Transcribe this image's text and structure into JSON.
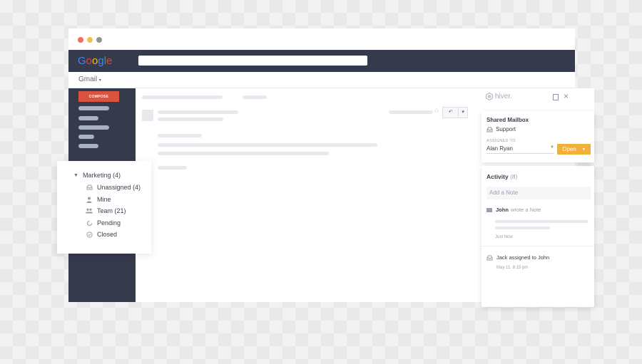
{
  "colors": {
    "topbar": "#353a4c",
    "sidebar": "#353a4c",
    "compose": "#d9533f",
    "open_button": "#f0b039",
    "dot_red": "#ee6b5e",
    "dot_yellow": "#f5bf4f",
    "dot_grey": "#8f9590",
    "google_blue": "#4285f4",
    "google_red": "#ea4335",
    "google_yellow": "#fbbc05",
    "google_green": "#34a853"
  },
  "browser": {
    "logo": [
      "G",
      "o",
      "o",
      "g",
      "l",
      "e"
    ],
    "app_menu": "Gmail"
  },
  "sidebar": {
    "compose_label": "COMPOSE"
  },
  "folders": {
    "group_label": "Marketing (4)",
    "items": [
      {
        "label": "Unassigned (4)",
        "icon": "inbox-icon"
      },
      {
        "label": "Mine",
        "icon": "person-icon"
      },
      {
        "label": "Team (21)",
        "icon": "team-icon"
      },
      {
        "label": "Pending",
        "icon": "pending-icon"
      },
      {
        "label": "Closed",
        "icon": "check-circle-icon"
      }
    ]
  },
  "hiver": {
    "logo_text": "hiver.",
    "shared_mailbox_title": "Shared Mailbox",
    "mailbox_name": "Support",
    "assigned_to_label": "ASSIGNED TO",
    "assignee": "Alan Ryan",
    "status_button": "Open",
    "activity_title": "Activity",
    "activity_count": "(8)",
    "note_placeholder": "Add a Note",
    "activities": [
      {
        "actor": "John",
        "action": "wrote a Note",
        "time": "Just Now"
      },
      {
        "text": "Jack assigned to John",
        "time": "May 11, 8:15 pm"
      }
    ]
  }
}
